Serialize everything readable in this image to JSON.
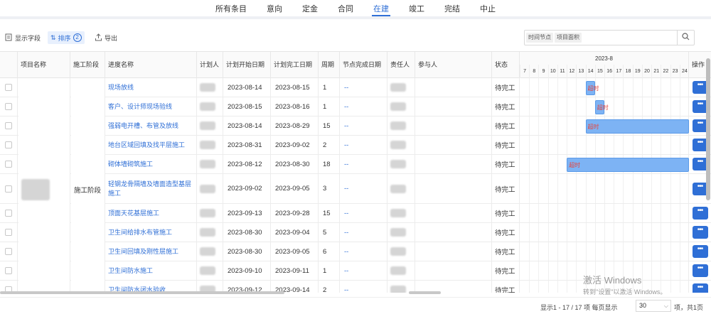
{
  "tabs": [
    {
      "label": "所有条目",
      "active": false
    },
    {
      "label": "意向",
      "active": false
    },
    {
      "label": "定金",
      "active": false
    },
    {
      "label": "合同",
      "active": false
    },
    {
      "label": "在建",
      "active": true
    },
    {
      "label": "竣工",
      "active": false
    },
    {
      "label": "完结",
      "active": false
    },
    {
      "label": "中止",
      "active": false
    }
  ],
  "toolbar": {
    "show_fields": "显示字段",
    "sort": "排序",
    "sort_count": "2",
    "export": "导出",
    "search_tags": [
      "时间节点",
      "项目面积"
    ],
    "search_value": ""
  },
  "columns": {
    "project": "项目名称",
    "stage": "施工阶段",
    "progress": "进度名称",
    "planner": "计划人",
    "start": "计划开始日期",
    "end": "计划完工日期",
    "period": "周期",
    "node_done": "节点完成日期",
    "owner": "责任人",
    "participants": "参与人",
    "status": "状态",
    "gantt_month": "2023-8",
    "gantt_days": [
      "7",
      "8",
      "9",
      "10",
      "11",
      "12",
      "13",
      "14",
      "15",
      "16",
      "17",
      "18",
      "19",
      "20",
      "21",
      "22",
      "23",
      "24"
    ],
    "ops": "操作"
  },
  "merged": {
    "stage": "施工阶段"
  },
  "rows": [
    {
      "name": "现场放线",
      "start": "2023-08-14",
      "end": "2023-08-15",
      "period": "1",
      "node_done": "--",
      "status": "待完工",
      "bar": {
        "label": "超时",
        "from": 14,
        "to": 15
      }
    },
    {
      "name": "客户、设计师现场验线",
      "start": "2023-08-15",
      "end": "2023-08-16",
      "period": "1",
      "node_done": "--",
      "status": "待完工",
      "bar": {
        "label": "超时",
        "from": 15,
        "to": 16
      }
    },
    {
      "name": "强弱电开槽、布管及放线",
      "start": "2023-08-14",
      "end": "2023-08-29",
      "period": "15",
      "node_done": "--",
      "status": "待完工",
      "bar": {
        "label": "超时",
        "from": 14,
        "to": 25
      }
    },
    {
      "name": "地台区域回填及找平层施工",
      "start": "2023-08-31",
      "end": "2023-09-02",
      "period": "2",
      "node_done": "--",
      "status": "待完工",
      "bar": null
    },
    {
      "name": "砌体墙砌筑施工",
      "start": "2023-08-12",
      "end": "2023-08-30",
      "period": "18",
      "node_done": "--",
      "status": "待完工",
      "bar": {
        "label": "超时",
        "from": 12,
        "to": 25
      }
    },
    {
      "name": "轻钢龙骨隔墙及墙面造型基层施工",
      "start": "2023-09-02",
      "end": "2023-09-05",
      "period": "3",
      "node_done": "--",
      "status": "待完工",
      "bar": null
    },
    {
      "name": "顶面天花基层施工",
      "start": "2023-09-13",
      "end": "2023-09-28",
      "period": "15",
      "node_done": "--",
      "status": "待完工",
      "bar": null
    },
    {
      "name": "卫生间给排水布管施工",
      "start": "2023-08-30",
      "end": "2023-09-04",
      "period": "5",
      "node_done": "--",
      "status": "待完工",
      "bar": null
    },
    {
      "name": "卫生间回填及刚性层施工",
      "start": "2023-08-30",
      "end": "2023-09-05",
      "period": "6",
      "node_done": "--",
      "status": "待完工",
      "bar": null
    },
    {
      "name": "卫生间防水施工",
      "start": "2023-09-10",
      "end": "2023-09-11",
      "period": "1",
      "node_done": "--",
      "status": "待完工",
      "bar": null
    },
    {
      "name": "卫生间防水闭水验收",
      "start": "2023-09-12",
      "end": "2023-09-14",
      "period": "2",
      "node_done": "--",
      "status": "待完工",
      "bar": null
    }
  ],
  "pagination": {
    "info": "显示1 - 17 / 17 项  每页显示",
    "page_size": "30",
    "info2": "项，共1页"
  },
  "watermark": {
    "line1": "激活 Windows",
    "line2": "转到\"设置\"以激活 Windows。"
  }
}
